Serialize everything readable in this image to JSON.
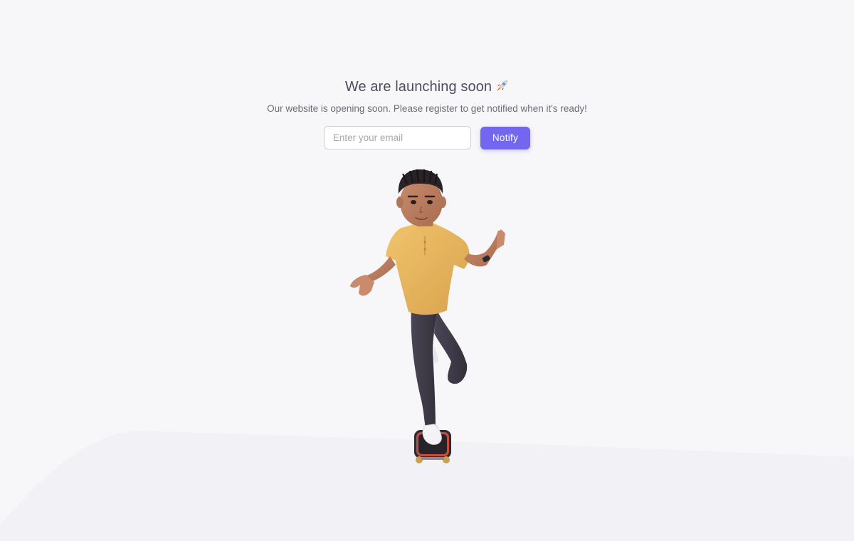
{
  "hero": {
    "title": "We are launching soon",
    "title_icon": "rocket-icon",
    "subtitle": "Our website is opening soon. Please register to get notified when it's ready!"
  },
  "form": {
    "email_placeholder": "Enter your email",
    "email_value": "",
    "notify_label": "Notify"
  },
  "illustration": {
    "icon": "boy-with-skateboard-illustration"
  },
  "colors": {
    "accent": "#7367f0",
    "background": "#f7f7f9",
    "heading": "#4f4d5c",
    "body_text": "#6d6b77",
    "input_border": "#d1d0d4",
    "shirt": "#e5b35d",
    "pants": "#3f3a48"
  }
}
